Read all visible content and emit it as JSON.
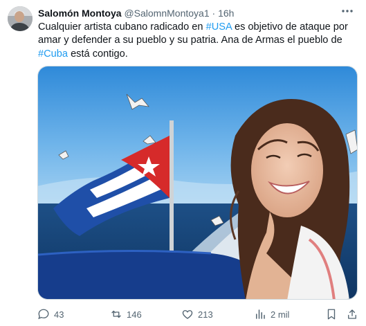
{
  "tweet": {
    "author_name": "Salomón Montoya",
    "handle": "@SalomnMontoya1",
    "separator": "·",
    "time": "16h",
    "text_parts": [
      {
        "text": "Cualquier artista cubano radicado en ",
        "type": "text"
      },
      {
        "text": "#USA",
        "type": "hashtag"
      },
      {
        "text": " es objetivo de ataque por amar y defender a su pueblo y su patria. Ana de Armas el pueblo de ",
        "type": "text"
      },
      {
        "text": "#Cuba",
        "type": "hashtag"
      },
      {
        "text": " está contigo.",
        "type": "text"
      }
    ]
  },
  "actions": {
    "replies": "43",
    "retweets": "146",
    "likes": "213",
    "views": "2 mil"
  },
  "icons": [
    "more-icon",
    "reply-icon",
    "retweet-icon",
    "like-icon",
    "views-icon",
    "bookmark-icon",
    "share-icon"
  ],
  "colors": {
    "text": "#0f1419",
    "secondary": "#536471",
    "hashtag": "#1d9bf0",
    "flag_blue": "#1f4fa8",
    "flag_red": "#d62a2a"
  }
}
